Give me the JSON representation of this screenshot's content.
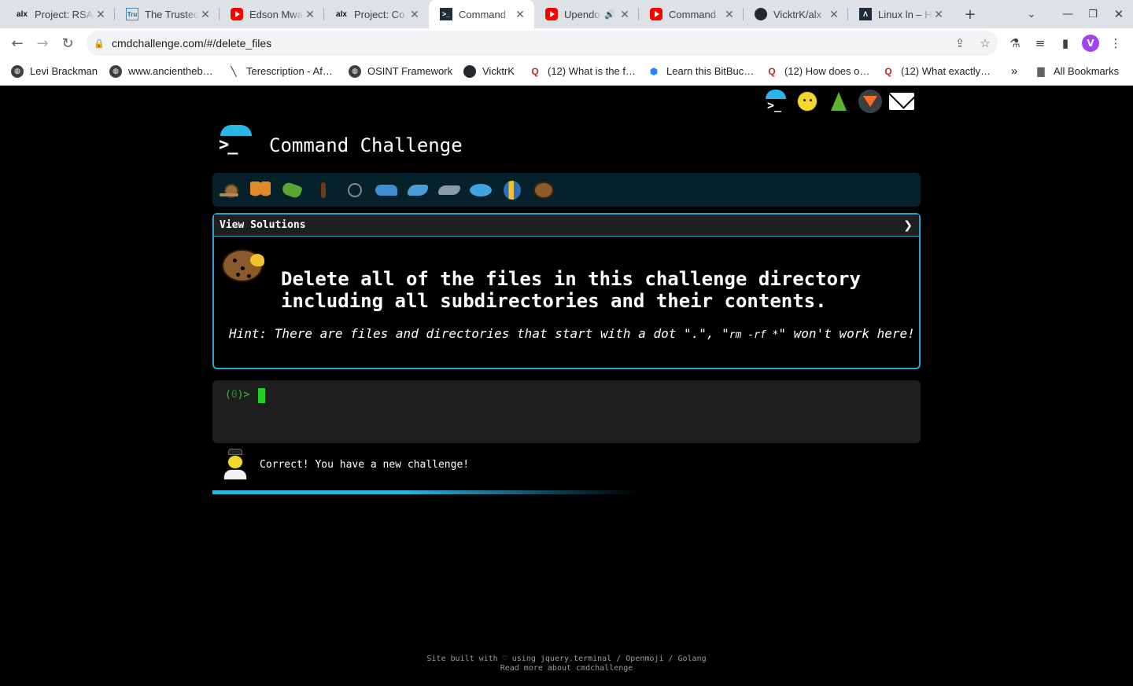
{
  "browser": {
    "tabs": [
      {
        "title": "Project: RSA",
        "favicon": "alx-icon"
      },
      {
        "title": "The Trusted",
        "favicon": "tru-icon"
      },
      {
        "title": "Edson Mwa",
        "favicon": "youtube-icon"
      },
      {
        "title": "Project: Co",
        "favicon": "alx-icon"
      },
      {
        "title": "Command",
        "favicon": "cmdchallenge-icon",
        "active": true
      },
      {
        "title": "Upendo",
        "favicon": "youtube-icon",
        "audio": true
      },
      {
        "title": "Command",
        "favicon": "youtube-icon"
      },
      {
        "title": "VicktrK/alx",
        "favicon": "github-icon"
      },
      {
        "title": "Linux ln – H",
        "favicon": "linux-icon"
      }
    ],
    "new_tab_symbol": "+",
    "url": "cmdchallenge.com/#/delete_files",
    "profile_initial": "V",
    "bookmarks": [
      {
        "label": "Levi Brackman",
        "icon": "globe-icon"
      },
      {
        "label": "www.ancientheb…",
        "icon": "globe-icon"
      },
      {
        "label": "Terescription - Af…",
        "icon": "pen-icon"
      },
      {
        "label": "OSINT Framework",
        "icon": "globe-icon"
      },
      {
        "label": "VicktrK",
        "icon": "github-icon"
      },
      {
        "label": "(12) What is the f…",
        "icon": "quora-icon"
      },
      {
        "label": "Learn this BitBuc…",
        "icon": "bitbucket-icon"
      },
      {
        "label": "(12) How does o…",
        "icon": "quora-icon"
      },
      {
        "label": "(12) What exactly…",
        "icon": "quora-icon"
      }
    ],
    "bookmarks_overflow": "»",
    "all_bookmarks": "All Bookmarks"
  },
  "site": {
    "title": "Command Challenge",
    "header_icons": [
      "terminal-icon",
      "shushing-face-icon",
      "tree-icon",
      "gitlab-icon",
      "envelope-icon"
    ],
    "progress_icons": [
      "snail-icon",
      "butterfly-icon",
      "caterpillar-icon",
      "ant-icon",
      "spider-web-icon",
      "whale-icon",
      "dolphin-icon",
      "dolphin-grey-icon",
      "fish-icon",
      "tropical-fish-icon",
      "blowfish-icon"
    ],
    "solutions_label": "View Solutions",
    "solutions_chevron": "❯",
    "challenge_icon": "blowfish-icon",
    "challenge_line1": "Delete all of the files in this challenge directory",
    "challenge_line2": "including all subdirectories and their contents.",
    "hint_pre": "Hint: There are files and directories that start with a dot \".\", \"",
    "hint_code": "rm -rf *",
    "hint_post": "\" won't work here!",
    "prompt_open": "(",
    "prompt_num": "0",
    "prompt_close": ")>",
    "feedback": "Correct! You have a new challenge!",
    "footer_line1": "Site built with ♡ using jquery.terminal / Openmoji / Golang",
    "footer_line2": "Read more about cmdchallenge"
  }
}
